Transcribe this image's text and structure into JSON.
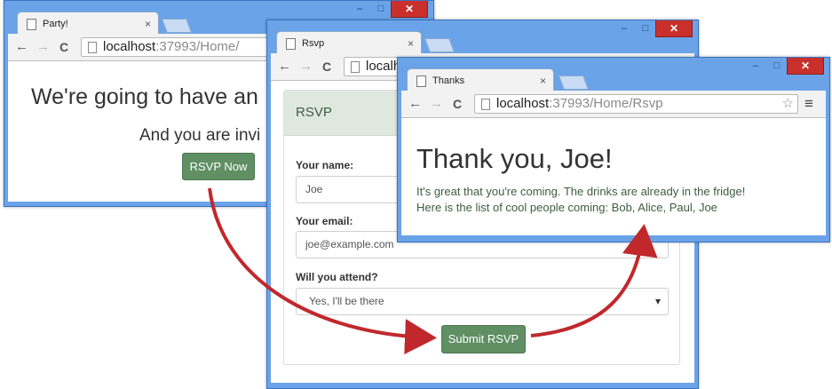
{
  "window1": {
    "tab_title": "Party!",
    "url_host": "localhost",
    "url_rest": ":37993/Home/",
    "heading": "We're going to have an",
    "subheading": "And you are invi",
    "rsvp_button": "RSVP Now"
  },
  "window2": {
    "tab_title": "Rsvp",
    "url_host": "localhost",
    "panel_title": "RSVP",
    "name_label": "Your name:",
    "name_value": "Joe",
    "email_label": "Your email:",
    "email_value": "joe@example.com",
    "attend_label": "Will you attend?",
    "attend_value": "Yes, I'll be there",
    "submit_button": "Submit RSVP"
  },
  "window3": {
    "tab_title": "Thanks",
    "url_host": "localhost",
    "url_rest": ":37993/Home/Rsvp",
    "heading": "Thank you, Joe!",
    "line1": "It's great that you're coming. The drinks are already in the fridge!",
    "line2": "Here is the list of cool people coming: Bob, Alice, Paul, Joe"
  },
  "controls": {
    "minimize": "–",
    "maximize": "□",
    "close": "✕",
    "back": "←",
    "forward": "→",
    "reload": "C",
    "star": "☆",
    "menu": "≡",
    "tab_close": "×",
    "dropdown_caret": "▾"
  },
  "colors": {
    "frame": "#6aa3e8",
    "button_green": "#5f8f63",
    "arrow_red": "#c0282c",
    "text_green": "#3d5d3f"
  }
}
